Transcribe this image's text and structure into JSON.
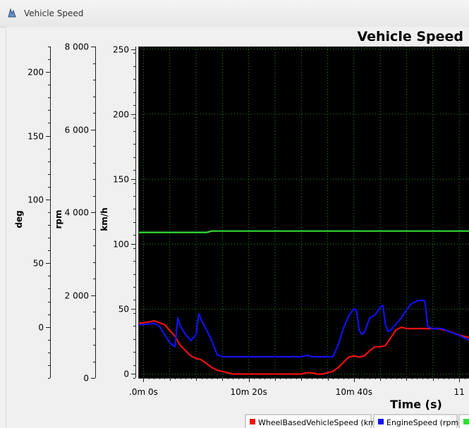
{
  "window": {
    "title": "Vehicle Speed"
  },
  "chart_data": {
    "type": "line",
    "title": "Vehicle Speed",
    "xlabel": "Time (s)",
    "x_tick_labels": [
      ".0m 0s",
      "10m 20s",
      "10m 40s",
      "11"
    ],
    "x_ticks_seconds": [
      600,
      620,
      640,
      660
    ],
    "xlim_seconds": [
      599,
      662
    ],
    "grid": true,
    "background": "#000000",
    "axes": [
      {
        "label": "deg",
        "ticks": [
          0,
          50,
          100,
          150,
          200
        ],
        "tick_labels": [
          "0",
          "50",
          "100",
          "150",
          "200"
        ],
        "ylim": [
          -40,
          220
        ]
      },
      {
        "label": "rpm",
        "ticks": [
          0,
          2000,
          4000,
          6000,
          8000
        ],
        "tick_labels": [
          "0",
          "2 000",
          "4 000",
          "6 000",
          "8 000"
        ],
        "ylim": [
          0,
          8000
        ]
      },
      {
        "label": "km/h",
        "ticks": [
          0,
          50,
          100,
          150,
          200,
          250
        ],
        "tick_labels": [
          "0",
          "50",
          "100",
          "150",
          "200",
          "250"
        ],
        "ylim": [
          -3,
          252
        ]
      }
    ],
    "series": [
      {
        "name": "WheelBasedVehicleSpeed (km/h)",
        "color": "#ee1111",
        "axis": "km/h",
        "points": [
          [
            599,
            39
          ],
          [
            601,
            40
          ],
          [
            602,
            41
          ],
          [
            604,
            38
          ],
          [
            606,
            29
          ],
          [
            607,
            22
          ],
          [
            608,
            18
          ],
          [
            609,
            14
          ],
          [
            610,
            12
          ],
          [
            611,
            11
          ],
          [
            612,
            8
          ],
          [
            613,
            5
          ],
          [
            614,
            3
          ],
          [
            615,
            2
          ],
          [
            616,
            1
          ],
          [
            617,
            0
          ],
          [
            620,
            0
          ],
          [
            625,
            0
          ],
          [
            630,
            0
          ],
          [
            631,
            1
          ],
          [
            632,
            1
          ],
          [
            633,
            0
          ],
          [
            634,
            0
          ],
          [
            635,
            1
          ],
          [
            636,
            2
          ],
          [
            637,
            5
          ],
          [
            638,
            9
          ],
          [
            639,
            13
          ],
          [
            640,
            14
          ],
          [
            641,
            13
          ],
          [
            642,
            14
          ],
          [
            643,
            18
          ],
          [
            644,
            21
          ],
          [
            645,
            21
          ],
          [
            646,
            22
          ],
          [
            647,
            28
          ],
          [
            648,
            34
          ],
          [
            649,
            36
          ],
          [
            650,
            35
          ],
          [
            652,
            35
          ],
          [
            654,
            35
          ],
          [
            656,
            35
          ],
          [
            658,
            33
          ],
          [
            660,
            30
          ],
          [
            662,
            28
          ]
        ]
      },
      {
        "name": "EngineSpeed (rpm)",
        "color": "#1111ee",
        "axis": "rpm",
        "points": [
          [
            599,
            1280
          ],
          [
            601,
            1300
          ],
          [
            602,
            1320
          ],
          [
            603,
            1250
          ],
          [
            604,
            1050
          ],
          [
            605,
            850
          ],
          [
            606,
            750
          ],
          [
            606.5,
            1450
          ],
          [
            607,
            1250
          ],
          [
            608,
            1050
          ],
          [
            609,
            900
          ],
          [
            610,
            1050
          ],
          [
            610.5,
            1550
          ],
          [
            611,
            1400
          ],
          [
            612,
            1150
          ],
          [
            613,
            900
          ],
          [
            614,
            560
          ],
          [
            615,
            510
          ],
          [
            620,
            510
          ],
          [
            625,
            510
          ],
          [
            630,
            510
          ],
          [
            631,
            550
          ],
          [
            632,
            510
          ],
          [
            636,
            510
          ],
          [
            637,
            800
          ],
          [
            638,
            1200
          ],
          [
            639,
            1500
          ],
          [
            640,
            1670
          ],
          [
            640.5,
            1630
          ],
          [
            641,
            1150
          ],
          [
            641.5,
            1050
          ],
          [
            642,
            1100
          ],
          [
            643,
            1450
          ],
          [
            644,
            1520
          ],
          [
            645,
            1710
          ],
          [
            645.5,
            1750
          ],
          [
            646,
            1280
          ],
          [
            646.5,
            1120
          ],
          [
            647,
            1160
          ],
          [
            648,
            1300
          ],
          [
            649,
            1450
          ],
          [
            650,
            1650
          ],
          [
            651,
            1800
          ],
          [
            652,
            1860
          ],
          [
            653,
            1880
          ],
          [
            653.5,
            1850
          ],
          [
            654,
            1250
          ],
          [
            655,
            1180
          ],
          [
            656,
            1200
          ],
          [
            657,
            1180
          ],
          [
            658,
            1120
          ],
          [
            660,
            1030
          ],
          [
            662,
            900
          ]
        ]
      },
      {
        "name": "",
        "color": "#33dd33",
        "axis": "km/h",
        "points": [
          [
            599,
            109
          ],
          [
            612,
            109
          ],
          [
            613,
            110
          ],
          [
            662,
            110
          ]
        ]
      }
    ],
    "legend": {
      "placement": "bottom",
      "entries": [
        "WheelBasedVehicleSpeed (km/h)",
        "EngineSpeed (rpm)",
        ""
      ]
    }
  }
}
